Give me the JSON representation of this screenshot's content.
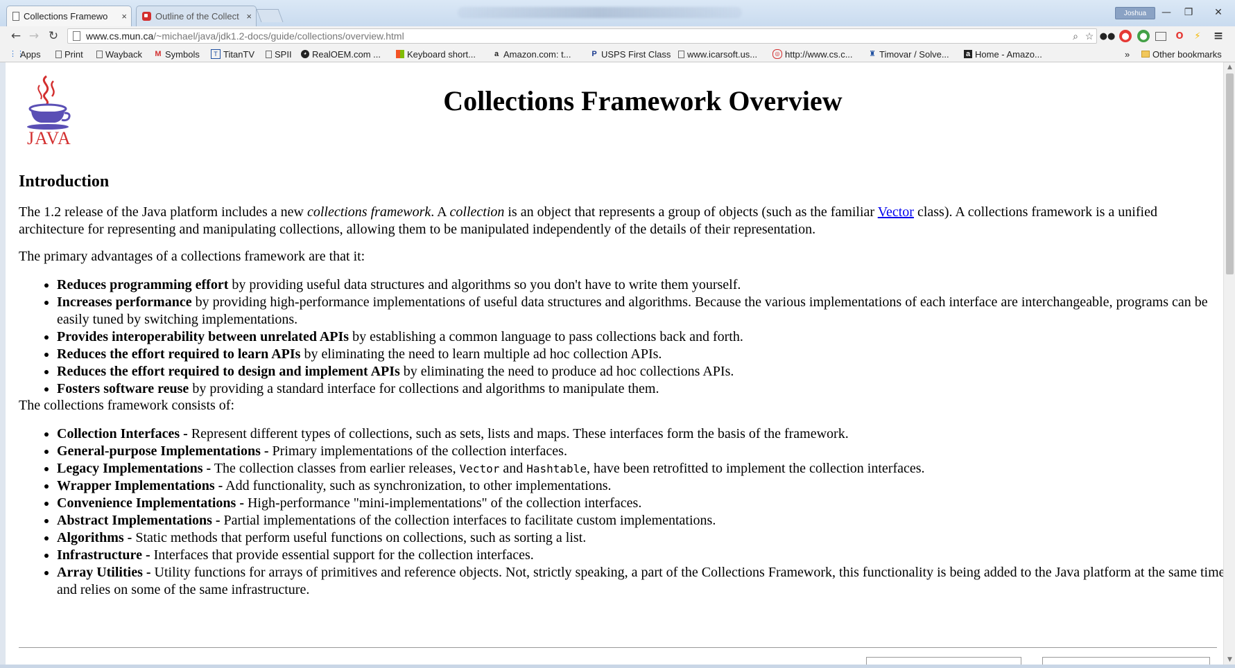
{
  "browser": {
    "tabs": [
      {
        "title": "Collections Framewo",
        "close": "×"
      },
      {
        "title": "Outline of the Collect",
        "close": "×"
      }
    ],
    "profile_name": "Joshua",
    "window_controls": {
      "minimize": "—",
      "maximize": "❐",
      "close": "✕"
    },
    "nav": {
      "back": "←",
      "forward": "→",
      "reload": "↻"
    },
    "url_host": "www.cs.mun.ca",
    "url_path": "/~michael/java/jdk1.2-docs/guide/collections/overview.html",
    "menu_icon": "≡"
  },
  "bookmarks": {
    "items": [
      {
        "label": "Apps",
        "icon": "apps-grid-icon"
      },
      {
        "label": "Print",
        "icon": "page-icon"
      },
      {
        "label": "Wayback",
        "icon": "page-icon"
      },
      {
        "label": "Symbols",
        "icon": "gmail-icon"
      },
      {
        "label": "TitanTV",
        "icon": "titantv-icon"
      },
      {
        "label": "SPII",
        "icon": "page-icon"
      },
      {
        "label": "RealOEM.com ...",
        "icon": "bmw-icon"
      },
      {
        "label": "Keyboard short...",
        "icon": "windows-icon"
      },
      {
        "label": "Amazon.com: t...",
        "icon": "amazon-icon"
      },
      {
        "label": "USPS First Class",
        "icon": "usps-icon"
      },
      {
        "label": "www.icarsoft.us...",
        "icon": "page-icon"
      },
      {
        "label": "http://www.cs.c...",
        "icon": "globe-icon"
      },
      {
        "label": "Timovar / Solve...",
        "icon": "timovar-icon"
      },
      {
        "label": "Home - Amazo...",
        "icon": "amazon-icon"
      }
    ],
    "overflow": "»",
    "other": "Other bookmarks"
  },
  "page": {
    "logo_text": "JAVA",
    "title": "Collections Framework Overview",
    "intro_heading": "Introduction",
    "intro": {
      "t1": "The 1.2 release of the Java platform includes a new ",
      "em1": "collections framework",
      "t2": ". A ",
      "em2": "collection",
      "t3": " is an object that represents a group of objects (such as the familiar ",
      "link": "Vector",
      "t4": " class). A collections framework is a unified architecture for representing and manipulating collections, allowing them to be manipulated independently of the details of their representation."
    },
    "advantages_intro": "The primary advantages of a collections framework are that it:",
    "advantages": [
      {
        "bold": "Reduces programming effort",
        "text": " by providing useful data structures and algorithms so you don't have to write them yourself."
      },
      {
        "bold": "Increases performance",
        "text": " by providing high-performance implementations of useful data structures and algorithms. Because the various implementations of each interface are interchangeable, programs can be easily tuned by switching implementations."
      },
      {
        "bold": "Provides interoperability between unrelated APIs",
        "text": " by establishing a common language to pass collections back and forth."
      },
      {
        "bold": "Reduces the effort required to learn APIs",
        "text": " by eliminating the need to learn multiple ad hoc collection APIs."
      },
      {
        "bold": "Reduces the effort required to design and implement APIs",
        "text": " by eliminating the need to produce ad hoc collections APIs."
      },
      {
        "bold": "Fosters software reuse",
        "text": " by providing a standard interface for collections and algorithms to manipulate them."
      }
    ],
    "consists_intro": "The collections framework consists of:",
    "components": [
      {
        "bold": "Collection Interfaces -",
        "text": " Represent different types of collections, such as sets, lists and maps. These interfaces form the basis of the framework."
      },
      {
        "bold": "General-purpose Implementations -",
        "text": " Primary implementations of the collection interfaces."
      },
      {
        "bold": "Legacy Implementations -",
        "text": " The collection classes from earlier releases, "
      },
      {
        "bold": "Wrapper Implementations -",
        "text": " Add functionality, such as synchronization, to other implementations."
      },
      {
        "bold": "Convenience Implementations -",
        "text": " High-performance \"mini-implementations\" of the collection interfaces."
      },
      {
        "bold": "Abstract Implementations -",
        "text": " Partial implementations of the collection interfaces to facilitate custom implementations."
      },
      {
        "bold": "Algorithms -",
        "text": " Static methods that perform useful functions on collections, such as sorting a list."
      },
      {
        "bold": "Infrastructure -",
        "text": " Interfaces that provide essential support for the collection interfaces."
      },
      {
        "bold": "Array Utilities -",
        "text": " Utility functions for arrays of primitives and reference objects. Not, strictly speaking, a part of the Collections Framework, this functionality is being added to the Java platform at the same time and relies on some of the same infrastructure."
      }
    ],
    "legacy_code1": "Vector",
    "legacy_and": " and ",
    "legacy_code2": "Hashtable",
    "legacy_tail": ", have been retrofitted to implement the collection interfaces."
  },
  "colors": {
    "link": "#0000ee",
    "java_red": "#d32f2f",
    "java_blue": "#5a4fb5"
  }
}
